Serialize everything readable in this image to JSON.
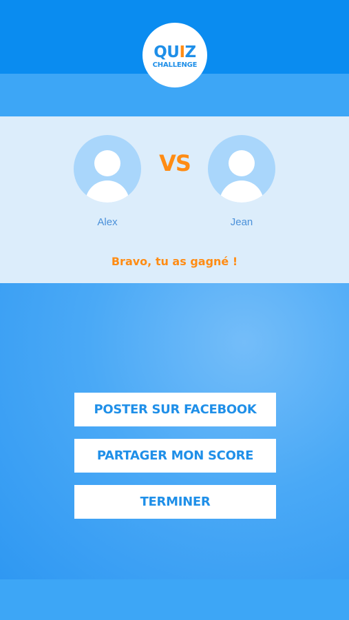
{
  "logo": {
    "quiz_part1": "QU",
    "quiz_part2": "I",
    "quiz_part3": "Z",
    "subtitle": "CHALLENGE"
  },
  "match": {
    "vs_label": "VS",
    "players": [
      {
        "name": "Alex"
      },
      {
        "name": "Jean"
      }
    ],
    "result_message": "Bravo, tu as gagné !"
  },
  "actions": {
    "facebook_label": "POSTER SUR FACEBOOK",
    "share_label": "PARTAGER MON SCORE",
    "finish_label": "TERMINER"
  },
  "colors": {
    "primary_blue": "#1f8fe8",
    "accent_orange": "#ff8c14",
    "panel_light": "#dcedfb",
    "avatar_bg": "#a9d6fb"
  },
  "icons": {
    "avatar": "user-placeholder-icon"
  }
}
